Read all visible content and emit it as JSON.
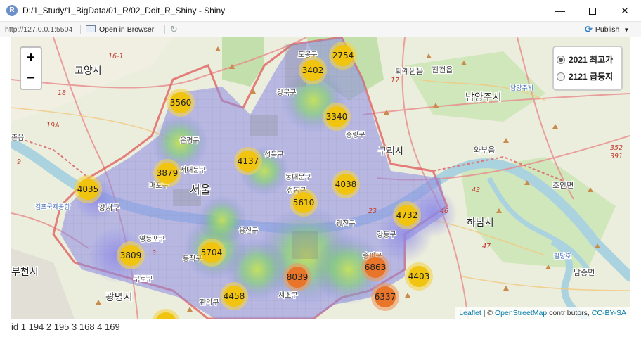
{
  "window": {
    "app_icon": "R",
    "title": "D:/1_Study/1_BigData/01_R/02_Doit_R_Shiny - Shiny",
    "minimize_glyph": "—",
    "close_glyph": "✕"
  },
  "toolbar": {
    "url": "http://127.0.0.1:5504",
    "open_in_browser": "Open in Browser",
    "refresh_glyph": "↻",
    "publish_icon_glyph": "⟳",
    "publish": "Publish",
    "publish_caret": "▼"
  },
  "map": {
    "zoom_in": "+",
    "zoom_out": "−",
    "layers": [
      {
        "label": "2021 최고가",
        "checked": true
      },
      {
        "label": "2121 급등지",
        "checked": false
      }
    ],
    "attribution": {
      "leaflet": "Leaflet",
      "separator": " | © ",
      "osm": "OpenStreetMap",
      "contributors": " contributors, ",
      "license": "CC-BY-SA"
    },
    "place_labels": [
      {
        "text": "고양시",
        "size": 14
      },
      {
        "text": "도봉구",
        "size": 10
      },
      {
        "text": "강북구",
        "size": 10
      },
      {
        "text": "퇴계원읍",
        "size": 11
      },
      {
        "text": "진건읍",
        "size": 11
      },
      {
        "text": "남양주시",
        "size": 14
      },
      {
        "text": "남양주시",
        "size": 9
      },
      {
        "text": "은평구",
        "size": 10
      },
      {
        "text": "중랑구",
        "size": 10
      },
      {
        "text": "구리시",
        "size": 13
      },
      {
        "text": "와부읍",
        "size": 11
      },
      {
        "text": "성북구",
        "size": 10
      },
      {
        "text": "서대문구",
        "size": 10
      },
      {
        "text": "마포구",
        "size": 10
      },
      {
        "text": "서울",
        "size": 16
      },
      {
        "text": "동대문구",
        "size": 10
      },
      {
        "text": "성동구",
        "size": 10
      },
      {
        "text": "조안면",
        "size": 11
      },
      {
        "text": "김포국제공항",
        "size": 9
      },
      {
        "text": "강서구",
        "size": 11
      },
      {
        "text": "광진구",
        "size": 10
      },
      {
        "text": "하남시",
        "size": 14
      },
      {
        "text": "용산구",
        "size": 10
      },
      {
        "text": "강동구",
        "size": 10
      },
      {
        "text": "영등포구",
        "size": 10
      },
      {
        "text": "동작구",
        "size": 10
      },
      {
        "text": "송파구",
        "size": 10
      },
      {
        "text": "부천시",
        "size": 14
      },
      {
        "text": "구로구",
        "size": 10
      },
      {
        "text": "남종면",
        "size": 11
      },
      {
        "text": "광명시",
        "size": 14
      },
      {
        "text": "관악구",
        "size": 10
      },
      {
        "text": "서초구",
        "size": 10
      },
      {
        "text": "팔당호",
        "size": 9
      },
      {
        "text": "촌읍",
        "size": 10
      }
    ],
    "road_numbers": [
      "16-1",
      "18",
      "19A",
      "9",
      "352",
      "391",
      "43",
      "46",
      "47",
      "23",
      "17",
      "3"
    ],
    "clusters": [
      {
        "count": "2754",
        "tone": "yellow"
      },
      {
        "count": "3402",
        "tone": "yellow"
      },
      {
        "count": "3560",
        "tone": "yellow"
      },
      {
        "count": "3340",
        "tone": "yellow"
      },
      {
        "count": "4137",
        "tone": "yellow"
      },
      {
        "count": "3879",
        "tone": "yellow"
      },
      {
        "count": "4038",
        "tone": "yellow"
      },
      {
        "count": "4035",
        "tone": "yellow"
      },
      {
        "count": "5610",
        "tone": "yellow"
      },
      {
        "count": "4732",
        "tone": "yellow"
      },
      {
        "count": "5704",
        "tone": "yellow"
      },
      {
        "count": "3809",
        "tone": "yellow"
      },
      {
        "count": "6863",
        "tone": "orange"
      },
      {
        "count": "8039",
        "tone": "orange"
      },
      {
        "count": "4403",
        "tone": "yellow"
      },
      {
        "count": "4458",
        "tone": "yellow"
      },
      {
        "count": "6337",
        "tone": "orange"
      }
    ],
    "cluster_colors": {
      "yellow": "#f1c40f",
      "yellow_halo": "#f4d24a",
      "orange": "#e8752a",
      "orange_halo": "#ef9a5c"
    }
  },
  "output_text": "id 1 194 2 195 3 168 4 169"
}
